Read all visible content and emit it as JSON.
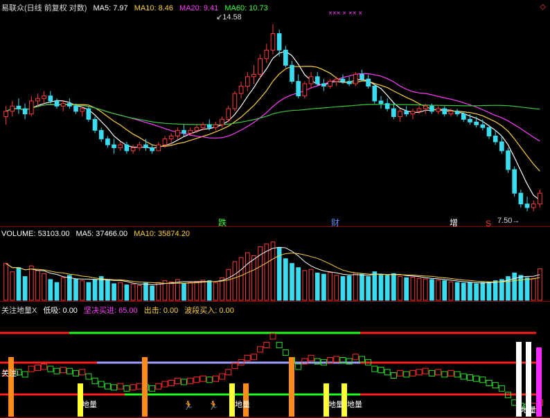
{
  "header": {
    "price": {
      "name": "易联众(日线 前复权 对数)",
      "items": [
        {
          "label": "MA5: 7.97",
          "color": "#ffffff"
        },
        {
          "label": "MA10: 8.46",
          "color": "#ffd23c"
        },
        {
          "label": "MA20: 9.41",
          "color": "#ff3cff"
        },
        {
          "label": "MA60: 10.73",
          "color": "#3cff3c"
        }
      ]
    },
    "volume": {
      "items": [
        {
          "label": "VOLUME: 53103.00",
          "color": "#ffffff"
        },
        {
          "label": "MA5: 37466.00",
          "color": "#ffffff"
        },
        {
          "label": "MA10: 35874.20",
          "color": "#ffd23c"
        }
      ]
    },
    "indicator": {
      "name": "关注地量X",
      "items": [
        {
          "label": "低吸: 0.00",
          "color": "#ffffff"
        },
        {
          "label": "坚决买进: 65.00",
          "color": "#ff3cff"
        },
        {
          "label": "出击: 0.00",
          "color": "#ffd23c"
        },
        {
          "label": "波段买入: 0.00",
          "color": "#ffd23c"
        }
      ]
    }
  },
  "labels": {
    "high_price": "14.58",
    "low_price": "7.50",
    "events": [
      "跌",
      "财",
      "增",
      "S"
    ],
    "xx_marks": "××× × ×× ×",
    "guanzhu": "关注!",
    "diliang": "地量",
    "diamond": "◇"
  },
  "colors": {
    "up": "#ff3c3c",
    "down": "#3cdcf0",
    "ma5": "#ffffff",
    "ma10": "#ffd23c",
    "ma20": "#ff3cff",
    "ma60": "#3cc83c"
  },
  "chart_data": {
    "type": "candlestick",
    "title": "易联众(日线 前复权 对数)",
    "ylim": [
      7.2,
      15.2
    ],
    "candles": [
      [
        10.5,
        10.9,
        10.2,
        10.7
      ],
      [
        10.7,
        11.1,
        10.5,
        10.9
      ],
      [
        10.9,
        11.2,
        10.6,
        10.8
      ],
      [
        10.8,
        11.0,
        10.4,
        10.6
      ],
      [
        10.6,
        11.3,
        10.5,
        11.1
      ],
      [
        11.1,
        11.4,
        10.9,
        11.2
      ],
      [
        11.2,
        11.5,
        11.0,
        11.3
      ],
      [
        11.3,
        11.5,
        11.0,
        11.1
      ],
      [
        11.1,
        11.2,
        10.8,
        10.9
      ],
      [
        10.9,
        11.1,
        10.7,
        11.0
      ],
      [
        11.0,
        11.2,
        10.8,
        10.9
      ],
      [
        10.9,
        11.0,
        10.6,
        10.7
      ],
      [
        10.7,
        10.9,
        10.5,
        10.8
      ],
      [
        10.8,
        10.9,
        10.3,
        10.4
      ],
      [
        10.4,
        10.5,
        9.9,
        10.0
      ],
      [
        10.0,
        10.1,
        9.6,
        9.7
      ],
      [
        9.7,
        9.8,
        9.4,
        9.5
      ],
      [
        9.5,
        9.7,
        9.2,
        9.4
      ],
      [
        9.4,
        9.6,
        9.3,
        9.5
      ],
      [
        9.5,
        9.6,
        9.2,
        9.3
      ],
      [
        9.3,
        9.5,
        9.2,
        9.4
      ],
      [
        9.4,
        9.6,
        9.3,
        9.5
      ],
      [
        9.5,
        9.7,
        9.3,
        9.4
      ],
      [
        9.4,
        9.5,
        9.2,
        9.3
      ],
      [
        9.3,
        9.6,
        9.3,
        9.5
      ],
      [
        9.5,
        9.8,
        9.4,
        9.7
      ],
      [
        9.7,
        9.9,
        9.5,
        9.8
      ],
      [
        9.8,
        10.1,
        9.7,
        10.0
      ],
      [
        10.0,
        10.2,
        9.8,
        9.9
      ],
      [
        9.9,
        10.1,
        9.8,
        10.0
      ],
      [
        10.0,
        10.2,
        9.9,
        10.1
      ],
      [
        10.1,
        10.3,
        10.0,
        10.2
      ],
      [
        10.2,
        10.4,
        10.0,
        10.1
      ],
      [
        10.1,
        10.3,
        10.0,
        10.2
      ],
      [
        10.2,
        10.5,
        10.1,
        10.4
      ],
      [
        10.4,
        10.9,
        10.3,
        10.8
      ],
      [
        10.8,
        11.5,
        10.7,
        11.4
      ],
      [
        11.4,
        11.9,
        11.2,
        11.7
      ],
      [
        11.7,
        12.3,
        11.5,
        12.1
      ],
      [
        12.1,
        12.6,
        11.8,
        12.2
      ],
      [
        12.2,
        13.1,
        12.0,
        12.9
      ],
      [
        12.9,
        13.6,
        12.7,
        13.3
      ],
      [
        13.3,
        14.58,
        13.1,
        14.1
      ],
      [
        14.1,
        14.3,
        13.0,
        13.3
      ],
      [
        13.3,
        13.5,
        12.5,
        12.6
      ],
      [
        12.6,
        12.8,
        11.8,
        11.9
      ],
      [
        11.9,
        12.2,
        11.2,
        11.3
      ],
      [
        11.3,
        11.9,
        11.2,
        11.8
      ],
      [
        11.8,
        12.3,
        11.6,
        12.1
      ],
      [
        12.1,
        12.3,
        11.7,
        11.8
      ],
      [
        11.8,
        12.0,
        11.5,
        11.7
      ],
      [
        11.7,
        12.0,
        11.6,
        11.9
      ],
      [
        11.9,
        12.1,
        11.7,
        12.0
      ],
      [
        12.0,
        12.2,
        11.8,
        11.9
      ],
      [
        11.9,
        12.1,
        11.7,
        11.8
      ],
      [
        11.8,
        12.3,
        11.7,
        12.2
      ],
      [
        12.2,
        12.4,
        11.9,
        12.0
      ],
      [
        12.0,
        12.2,
        11.6,
        11.7
      ],
      [
        11.7,
        11.8,
        11.0,
        11.1
      ],
      [
        11.1,
        11.3,
        10.8,
        11.0
      ],
      [
        11.0,
        11.2,
        10.7,
        10.8
      ],
      [
        10.8,
        11.0,
        10.4,
        10.5
      ],
      [
        10.5,
        10.8,
        10.3,
        10.7
      ],
      [
        10.7,
        10.9,
        10.5,
        10.6
      ],
      [
        10.6,
        10.8,
        10.4,
        10.7
      ],
      [
        10.7,
        10.9,
        10.6,
        10.8
      ],
      [
        10.8,
        11.0,
        10.6,
        10.9
      ],
      [
        10.9,
        11.0,
        10.6,
        10.7
      ],
      [
        10.7,
        10.9,
        10.6,
        10.8
      ],
      [
        10.8,
        10.9,
        10.5,
        10.6
      ],
      [
        10.6,
        10.8,
        10.5,
        10.7
      ],
      [
        10.7,
        10.8,
        10.5,
        10.6
      ],
      [
        10.6,
        10.7,
        10.3,
        10.4
      ],
      [
        10.4,
        10.6,
        10.2,
        10.3
      ],
      [
        10.3,
        10.5,
        10.1,
        10.2
      ],
      [
        10.2,
        10.4,
        10.0,
        10.1
      ],
      [
        10.1,
        10.2,
        9.7,
        9.8
      ],
      [
        9.8,
        10.0,
        9.5,
        9.6
      ],
      [
        9.6,
        9.8,
        9.2,
        9.3
      ],
      [
        9.3,
        9.4,
        8.6,
        8.7
      ],
      [
        8.7,
        8.8,
        7.9,
        8.0
      ],
      [
        8.0,
        8.1,
        7.6,
        7.7
      ],
      [
        7.7,
        7.9,
        7.5,
        7.6
      ],
      [
        7.6,
        7.8,
        7.5,
        7.7
      ],
      [
        7.7,
        8.1,
        7.6,
        8.0
      ]
    ],
    "volume": [
      62,
      48,
      55,
      40,
      58,
      50,
      45,
      35,
      30,
      38,
      42,
      36,
      33,
      30,
      35,
      40,
      34,
      28,
      30,
      26,
      27,
      25,
      29,
      24,
      30,
      33,
      31,
      35,
      28,
      30,
      32,
      34,
      33,
      30,
      38,
      52,
      65,
      72,
      80,
      75,
      90,
      95,
      98,
      88,
      70,
      62,
      55,
      50,
      52,
      46,
      44,
      47,
      42,
      40,
      41,
      46,
      44,
      40,
      48,
      43,
      42,
      45,
      40,
      38,
      39,
      37,
      36,
      35,
      34,
      33,
      31,
      30,
      29,
      30,
      28,
      30,
      31,
      33,
      35,
      40,
      46,
      42,
      38,
      37,
      53
    ],
    "volume_ylim": [
      0,
      100
    ]
  }
}
